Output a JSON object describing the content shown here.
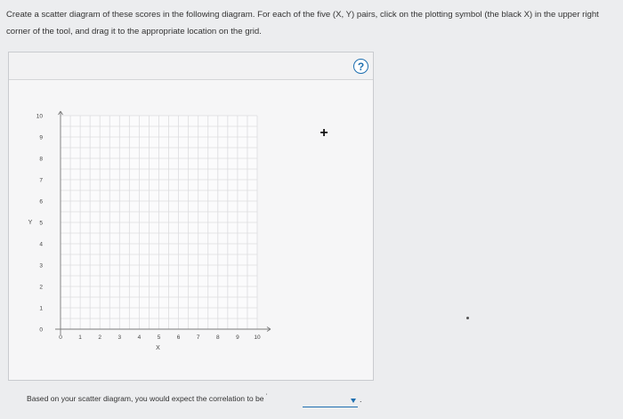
{
  "instructions": "Create a scatter diagram of these scores in the following diagram. For each of the five (X, Y) pairs, click on the plotting symbol (the black X) in the upper right corner of the tool, and drag it to the appropriate location on the grid.",
  "help_button": {
    "label": "?"
  },
  "plot_symbol": {
    "glyph": "+"
  },
  "graph": {
    "x_ticks": [
      "0",
      "1",
      "2",
      "3",
      "4",
      "5",
      "6",
      "7",
      "8",
      "9",
      "10"
    ],
    "y_ticks": [
      "0",
      "1",
      "2",
      "3",
      "4",
      "5",
      "6",
      "7",
      "8",
      "9",
      "10"
    ],
    "x_label": "X",
    "y_label": "Y",
    "x_range": [
      0,
      10
    ],
    "y_range": [
      0,
      10
    ],
    "grid_minor_per_unit": 2,
    "plotted_points": []
  },
  "question": {
    "text": "Based on your scatter diagram, you would expect the correlation to be",
    "selected_value": "",
    "end_punct": "."
  },
  "colors": {
    "accent": "#1e6fb0",
    "grid": "#dcdcdf",
    "axis": "#7a7a7a"
  }
}
